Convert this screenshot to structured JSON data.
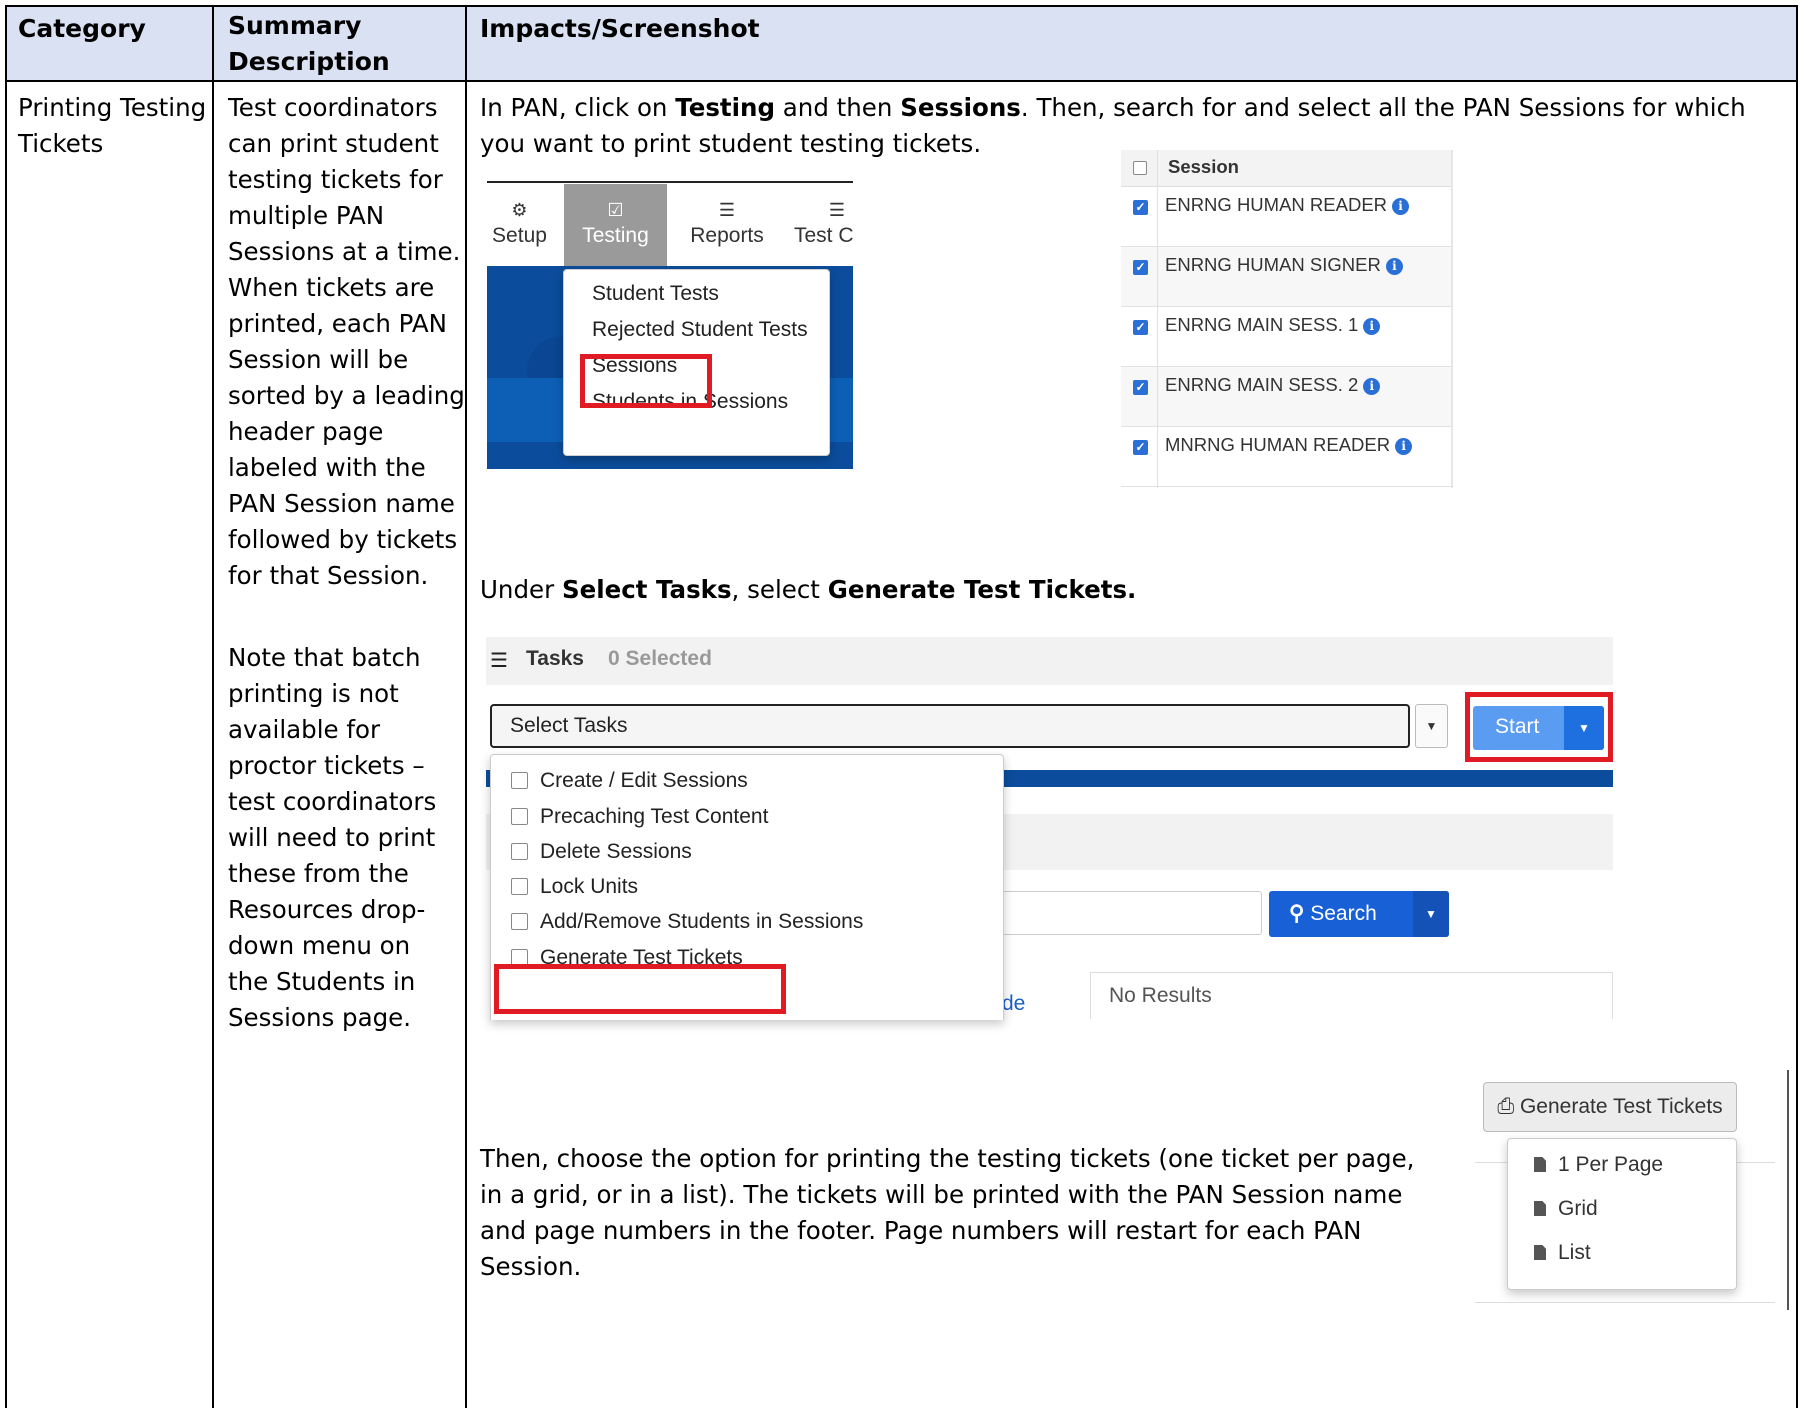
{
  "table": {
    "headers": {
      "category": "Category",
      "summary": "Summary\nDescription",
      "impacts": "Impacts/Screenshot"
    },
    "row": {
      "category": "Printing Testing\nTickets",
      "summary_p1": "Test coordinators\ncan print student\ntesting tickets for\nmultiple PAN\nSessions at a time.\nWhen tickets are\nprinted, each PAN\nSession will be\nsorted by a leading\nheader page\nlabeled with the\nPAN Session name\nfollowed by tickets\nfor that Session.",
      "summary_p2": "Note that batch\nprinting is not\navailable for\nproctor tickets –\ntest coordinators\nwill need to print\nthese from the\nResources drop-\ndown menu on\nthe Students in\nSessions page."
    }
  },
  "instructions": {
    "step1": {
      "t1": "In PAN, click on ",
      "b1": "Testing",
      "t2": " and then ",
      "b2": "Sessions",
      "t3": ". Then, search for and select all the PAN Sessions for which you want to print student testing tickets."
    },
    "step2": {
      "t1": "Under ",
      "b1": "Select Tasks",
      "t2": ", select ",
      "b2": "Generate Test Tickets."
    },
    "step3": "Then, choose the option for printing the testing tickets (one ticket per page, in a grid, or in a list). The tickets will be printed with the PAN Session name and page numbers in the footer. Page numbers will restart for each PAN Session."
  },
  "screenshot_menu": {
    "tabs": [
      {
        "label": "Setup",
        "icon": "gear-icon"
      },
      {
        "label": "Testing",
        "icon": "check-square-icon"
      },
      {
        "label": "Reports",
        "icon": "list-icon"
      },
      {
        "label": "Test C",
        "icon": "list-icon"
      }
    ],
    "menu_items": [
      "Student Tests",
      "Rejected Student Tests",
      "Sessions",
      "Students in Sessions"
    ],
    "highlight_color": "#e01b24"
  },
  "screenshot_sessions": {
    "header": "Session",
    "rows": [
      "ENRNG HUMAN READER",
      "ENRNG HUMAN SIGNER",
      "ENRNG MAIN SESS. 1",
      "ENRNG MAIN SESS. 2",
      "MNRNG HUMAN READER"
    ]
  },
  "screenshot_tasks": {
    "title": "Tasks",
    "selected_count": "0 Selected",
    "select_placeholder": "Select Tasks",
    "start_label": "Start",
    "options": [
      "Create / Edit Sessions",
      "Precaching Test Content",
      "Delete Sessions",
      "Lock Units",
      "Add/Remove Students in Sessions",
      "Generate Test Tickets"
    ],
    "search_label": "Search",
    "no_results": "No Results",
    "partial_text": "de"
  },
  "screenshot_tickets": {
    "button_label": "Generate Test Tickets",
    "options": [
      "1 Per Page",
      "Grid",
      "List"
    ]
  }
}
